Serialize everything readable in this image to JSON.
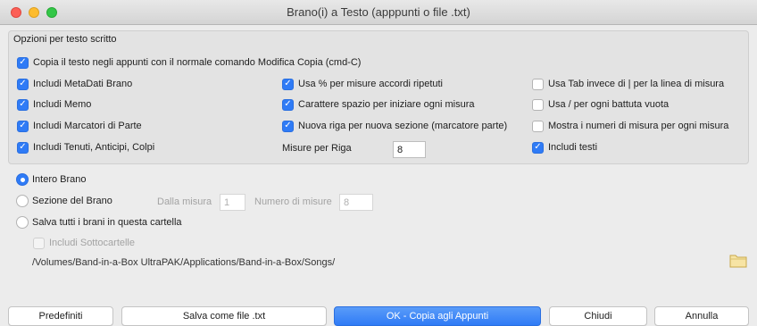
{
  "window": {
    "title": "Brano(i) a Testo (apppunti o file .txt)"
  },
  "options": {
    "group_title": "Opzioni per testo scritto",
    "copy_clipboard": {
      "label": "Copia il testo negli appunti con il normale comando Modifica Copia (cmd-C)",
      "checked": true
    },
    "col1": [
      {
        "label": "Includi MetaDati Brano",
        "checked": true
      },
      {
        "label": "Includi Memo",
        "checked": true
      },
      {
        "label": "Includi Marcatori di Parte",
        "checked": true
      },
      {
        "label": "Includi Tenuti, Anticipi, Colpi",
        "checked": true
      }
    ],
    "col2": [
      {
        "label": "Usa % per misure accordi ripetuti",
        "checked": true
      },
      {
        "label": "Carattere spazio per iniziare ogni misura",
        "checked": true
      },
      {
        "label": "Nuova riga per nuova sezione (marcatore parte)",
        "checked": true
      }
    ],
    "bars_per_line": {
      "label": "Misure per Riga",
      "value": "8"
    },
    "col3": [
      {
        "label": "Usa Tab invece di | per la linea di misura",
        "checked": false
      },
      {
        "label": "Usa / per ogni battuta vuota",
        "checked": false
      },
      {
        "label": "Mostra i numeri di misura per ogni misura",
        "checked": false
      },
      {
        "label": "Includi testi",
        "checked": true
      }
    ]
  },
  "scope": {
    "whole_song": {
      "label": "Intero Brano",
      "selected": true
    },
    "song_section": {
      "label": "Sezione del Brano",
      "selected": false
    },
    "from_bar": {
      "label": "Dalla misura",
      "value": "1"
    },
    "num_bars": {
      "label": "Numero di misure",
      "value": "8"
    },
    "save_all": {
      "label": "Salva tutti i brani in questa cartella",
      "selected": false
    },
    "include_subfolders": {
      "label": "Includi Sottocartelle",
      "checked": false
    },
    "folder_path": "/Volumes/Band-in-a-Box UltraPAK/Applications/Band-in-a-Box/Songs/"
  },
  "buttons": {
    "defaults": "Predefiniti",
    "save_txt": "Salva come file .txt",
    "ok_copy": "OK - Copia agli Appunti",
    "close": "Chiudi",
    "cancel": "Annulla"
  },
  "colors": {
    "accent": "#2f7bf6",
    "window_bg": "#ececec",
    "group_bg": "#e3e3e3"
  }
}
